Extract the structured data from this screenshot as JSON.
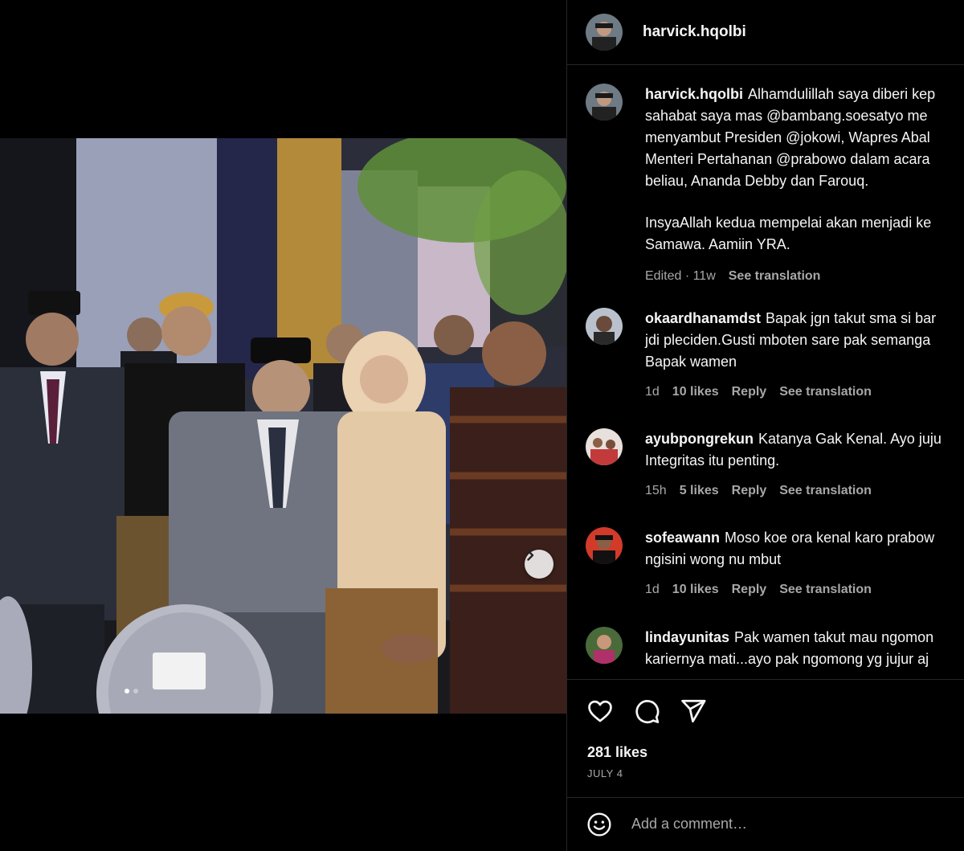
{
  "post": {
    "author": "harvick.hqolbi",
    "carousel": {
      "slide_count": 2,
      "active_slide": 1
    }
  },
  "caption": {
    "user": "harvick.hqolbi",
    "lines": [
      "Alhamdulillah saya diberi kep",
      "sahabat saya mas @bambang.soesatyo me",
      "menyambut Presiden @jokowi, Wapres Abal",
      "Menteri Pertahanan @prabowo dalam acara",
      "beliau, Ananda Debby dan Farouq.",
      "",
      "InsyaAllah kedua mempelai akan menjadi ke",
      "Samawa. Aamiin YRA."
    ],
    "meta": "Edited · 11w",
    "translate": "See translation"
  },
  "comments": [
    {
      "user": "okaardhanamdst",
      "lines": [
        "Bapak jgn takut sma si bar",
        "jdi pleciden.Gusti mboten sare pak semanga",
        "Bapak wamen"
      ],
      "time": "1d",
      "likes": "10 likes",
      "reply": "Reply",
      "translate": "See translation"
    },
    {
      "user": "ayubpongrekun",
      "lines": [
        "Katanya Gak Kenal. Ayo juju",
        "Integritas itu penting."
      ],
      "time": "15h",
      "likes": "5 likes",
      "reply": "Reply",
      "translate": "See translation"
    },
    {
      "user": "sofeawann",
      "lines": [
        "Moso koe ora kenal karo prabow",
        "ngisini wong nu mbut"
      ],
      "time": "1d",
      "likes": "10 likes",
      "reply": "Reply",
      "translate": "See translation"
    },
    {
      "user": "lindayunitas",
      "lines": [
        "Pak wamen takut mau ngomon",
        "kariernya mati...ayo pak ngomong yg jujur aj"
      ],
      "time": "",
      "likes": "",
      "reply": "",
      "translate": ""
    }
  ],
  "engagement": {
    "likes": "281 likes",
    "date": "JULY 4"
  },
  "compose": {
    "placeholder": "Add a comment…"
  },
  "icons": {
    "like": "heart-icon",
    "comment": "comment-bubble-icon",
    "share": "paper-plane-icon",
    "next": "chevron-right-icon",
    "emoji": "smiley-icon"
  },
  "colors": {
    "background": "#000000",
    "text": "#f5f5f5",
    "secondary": "#a8a8a8",
    "divider": "#262626"
  }
}
